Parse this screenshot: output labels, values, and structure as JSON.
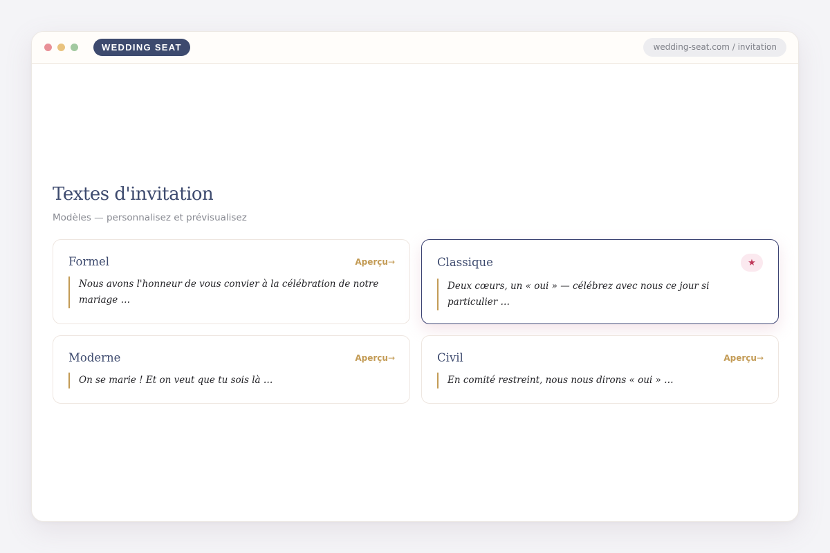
{
  "colors": {
    "brand_navy": "#3d4a6e",
    "accent_gold": "#c39b55",
    "rose": "#c0395a",
    "rose_bg": "#fbe9ef",
    "dot_red": "#e89097",
    "dot_yellow": "#e9c37f",
    "dot_green": "#a2c9a0"
  },
  "app": {
    "brand": "WEDDING SEAT",
    "url": "wedding-seat.com / invitation"
  },
  "page": {
    "title": "Textes d'invitation",
    "subtitle": "Modèles — personnalisez et prévisualisez"
  },
  "templates": [
    {
      "name": "Formel",
      "action": "Aperçu",
      "action_arrow": "→",
      "excerpt": "Nous avons l'honneur de vous convier à la célébration de notre mariage …",
      "selected": false
    },
    {
      "name": "Classique",
      "badge": "★",
      "excerpt": "Deux cœurs, un « oui » — célébrez avec nous ce jour si particulier …",
      "selected": true
    },
    {
      "name": "Moderne",
      "action": "Aperçu",
      "action_arrow": "→",
      "excerpt": "On se marie ! Et on veut que tu sois là …",
      "selected": false
    },
    {
      "name": "Civil",
      "action": "Aperçu",
      "action_arrow": "→",
      "excerpt": "En comité restreint, nous nous dirons « oui » …",
      "selected": false
    }
  ]
}
